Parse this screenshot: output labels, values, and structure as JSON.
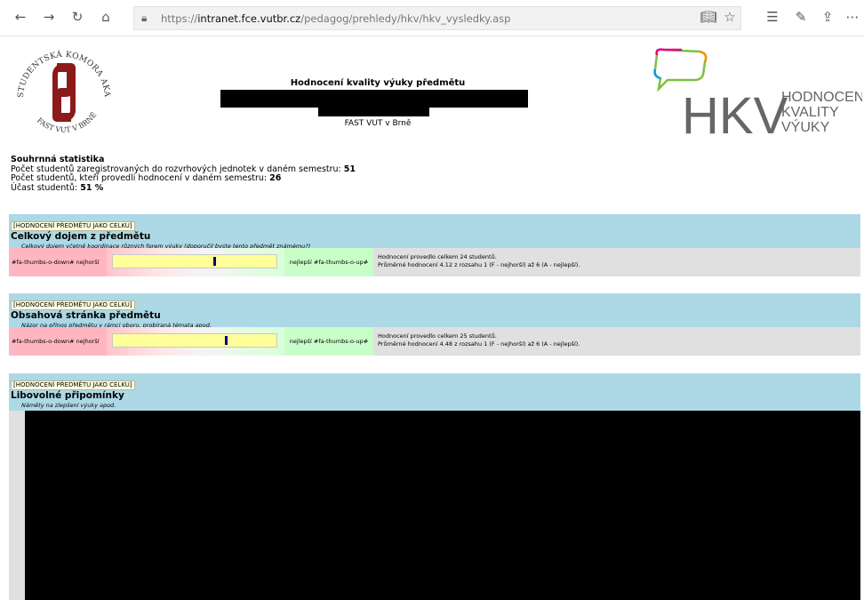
{
  "browser": {
    "url_scheme": "https://",
    "url_host": "intranet.fce.vutbr.cz",
    "url_path": "/pedagog/prehledy/hkv/hkv_vysledky.asp"
  },
  "header": {
    "seal_text_top": "STUDENTSKÁ KOMORA AKADEMICKÉHO SENÁTU",
    "seal_text_bottom": "FAST VUT V BRNĚ",
    "title": "Hodnocení kvality výuky předmětu",
    "faculty": "FAST VUT v Brně",
    "logo_letters": "HKV",
    "logo_line1": "HODNOCENÍ",
    "logo_line2": "KVALITY",
    "logo_line3": "VÝUKY"
  },
  "stats": {
    "heading": "Souhrnná statistika",
    "registered_label": "Počet studentů zaregistrovaných do rozvrhových jednotek v daném semestru: ",
    "registered_value": "51",
    "evaluated_label": "Počet studentů, kteří provedli hodnocení v daném semestru: ",
    "evaluated_value": "26",
    "participation_label": "Účast studentů: ",
    "participation_value": "51 %"
  },
  "sections": [
    {
      "tag": "[HODNOCENÍ PŘEDMĚTU JAKO CELKU]",
      "title": "Celkový dojem z předmětu",
      "desc": "Celkový dojem včetně koordinace různých forem výuky (doporučil byste tento předmět známému?)",
      "worst": "#fa-thumbs-o-down# nejhorší",
      "best": "nejlepší #fa-thumbs-o-up#",
      "rating": 4.12,
      "info_line1": "Hodnocení provedlo celkem 24 studentů.",
      "info_line2": "Průměrné hodnocení 4.12 z rozsahu 1 (F - nejhorší) až 6 (A - nejlepší)."
    },
    {
      "tag": "[HODNOCENÍ PŘEDMĚTU JAKO CELKU]",
      "title": "Obsahová stránka předmětu",
      "desc": "Názor na přínos předmětu v rámci oboru, probíraná témata apod.",
      "worst": "#fa-thumbs-o-down# nejhorší",
      "best": "nejlepší #fa-thumbs-o-up#",
      "rating": 4.48,
      "info_line1": "Hodnocení provedlo celkem 25 studentů.",
      "info_line2": "Průměrné hodnocení 4.48 z rozsahu 1 (F - nejhorší) až 6 (A - nejlepší)."
    },
    {
      "tag": "[HODNOCENÍ PŘEDMĚTU JAKO CELKU]",
      "title": "Libovolné připomínky",
      "desc": "Náměty na zlepšení výuky apod."
    }
  ],
  "icons": {
    "back": "back-arrow-icon",
    "forward": "forward-arrow-icon",
    "refresh": "refresh-icon",
    "home": "home-icon",
    "lock": "lock-icon",
    "reading": "reading-view-icon",
    "favorite": "star-icon",
    "favorites": "favorites-list-icon",
    "notes": "pen-icon",
    "share": "share-icon",
    "more": "more-icon"
  },
  "colors": {
    "section_bg": "#add8e6",
    "worst_bg": "#ffb6c1",
    "best_bg": "#c8ffc8",
    "bar_fill": "#ffff99",
    "marker": "#000080",
    "seal_red": "#8b1a1a"
  }
}
